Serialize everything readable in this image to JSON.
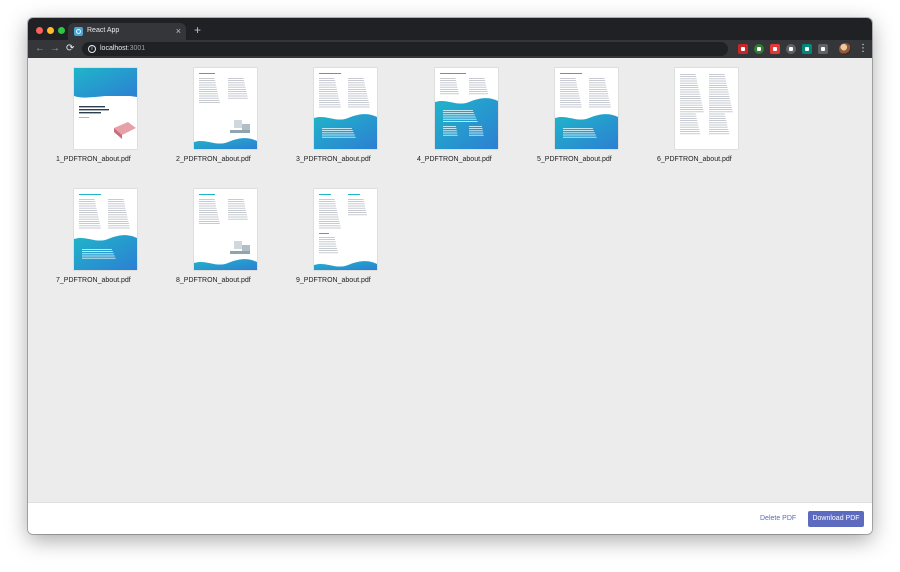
{
  "window": {
    "tab_title": "React App",
    "tab_close": "×",
    "new_tab": "+",
    "nav_back": "←",
    "nav_forward": "→",
    "nav_reload": "⟳",
    "info_icon": "i",
    "url_host": "localhost",
    "url_port": ":3001",
    "bookmark": "☆",
    "menu": "⋮",
    "extensions": [
      "extension-icon",
      "extension-icon",
      "extension-icon",
      "extension-icon",
      "extension-icon",
      "extension-icon"
    ]
  },
  "files": [
    {
      "name": "1_PDFTRON_about.pdf",
      "variant": "cover"
    },
    {
      "name": "2_PDFTRON_about.pdf",
      "variant": "illustration"
    },
    {
      "name": "3_PDFTRON_about.pdf",
      "variant": "text-wave"
    },
    {
      "name": "4_PDFTRON_about.pdf",
      "variant": "full-wave"
    },
    {
      "name": "5_PDFTRON_about.pdf",
      "variant": "text-wave"
    },
    {
      "name": "6_PDFTRON_about.pdf",
      "variant": "text-only"
    },
    {
      "name": "7_PDFTRON_about.pdf",
      "variant": "text-wave"
    },
    {
      "name": "8_PDFTRON_about.pdf",
      "variant": "illustration"
    },
    {
      "name": "9_PDFTRON_about.pdf",
      "variant": "text-small-wave"
    }
  ],
  "actions": {
    "delete_label": "Delete PDF",
    "download_label": "Download PDF"
  },
  "colors": {
    "accent": "#5c6bc0",
    "wave_start": "#1fb5c9",
    "wave_end": "#2d7fd3"
  }
}
